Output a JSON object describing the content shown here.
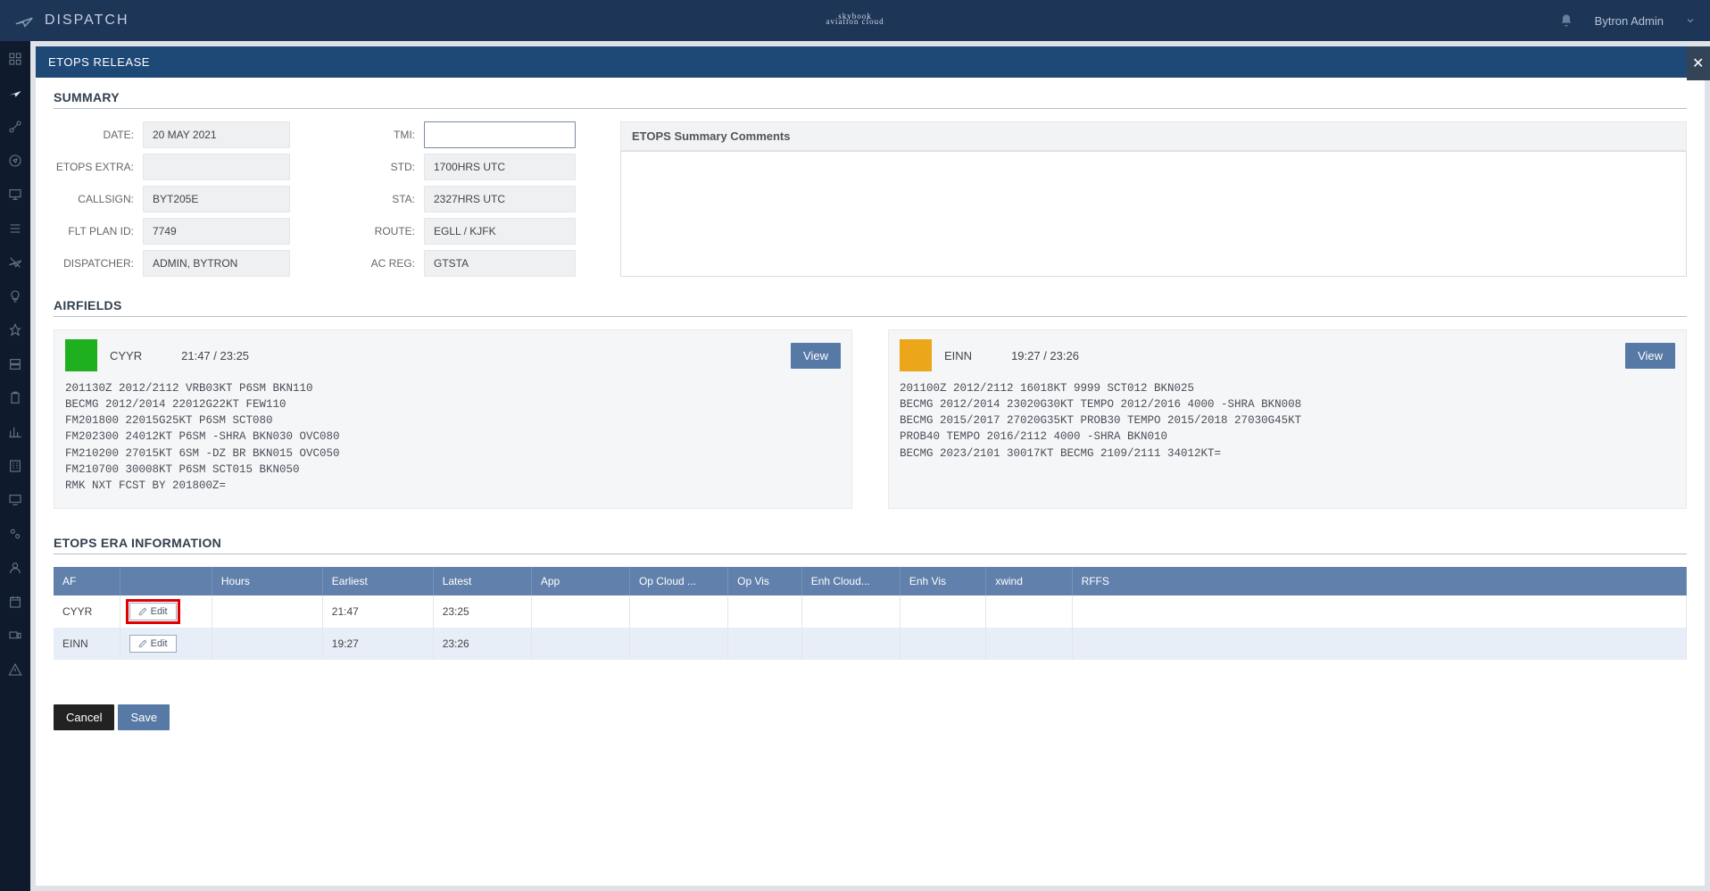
{
  "topbar": {
    "title": "DISPATCH",
    "brand": "skybook",
    "brand_sub": "aviation cloud",
    "user": "Bytron Admin"
  },
  "panel_title": "ETOPS RELEASE",
  "sections": {
    "summary": "SUMMARY",
    "airfields": "AIRFIELDS",
    "era": "ETOPS ERA INFORMATION"
  },
  "summary": {
    "labels": {
      "date": "DATE:",
      "etops_extra": "ETOPS EXTRA:",
      "callsign": "CALLSIGN:",
      "flt_plan_id": "FLT PLAN ID:",
      "dispatcher": "DISPATCHER:",
      "tmi": "TMI:",
      "std": "STD:",
      "sta": "STA:",
      "route": "ROUTE:",
      "ac_reg": "AC REG:"
    },
    "values": {
      "date": "20 MAY 2021",
      "etops_extra": "",
      "callsign": "BYT205E",
      "flt_plan_id": "7749",
      "dispatcher": "ADMIN, BYTRON",
      "tmi": "",
      "std": "1700HRS UTC",
      "sta": "2327HRS UTC",
      "route": "EGLL / KJFK",
      "ac_reg": "GTSTA"
    },
    "comments_label": "ETOPS Summary Comments",
    "comments_value": ""
  },
  "airfields": [
    {
      "status": "green",
      "code": "CYYR",
      "time": "21:47 / 23:25",
      "view": "View",
      "taf": "201130Z 2012/2112 VRB03KT P6SM BKN110\nBECMG 2012/2014 22012G22KT FEW110\nFM201800 22015G25KT P6SM SCT080\nFM202300 24012KT P6SM -SHRA BKN030 OVC080\nFM210200 27015KT 6SM -DZ BR BKN015 OVC050\nFM210700 30008KT P6SM SCT015 BKN050\nRMK NXT FCST BY 201800Z="
    },
    {
      "status": "amber",
      "code": "EINN",
      "time": "19:27 / 23:26",
      "view": "View",
      "taf": "201100Z 2012/2112 16018KT 9999 SCT012 BKN025\nBECMG 2012/2014 23020G30KT TEMPO 2012/2016 4000 -SHRA BKN008\nBECMG 2015/2017 27020G35KT PROB30 TEMPO 2015/2018 27030G45KT\nPROB40 TEMPO 2016/2112 4000 -SHRA BKN010\nBECMG 2023/2101 30017KT BECMG 2109/2111 34012KT="
    }
  ],
  "era_table": {
    "headers": [
      "AF",
      "",
      "Hours",
      "Earliest",
      "Latest",
      "App",
      "Op Cloud ...",
      "Op Vis",
      "Enh Cloud...",
      "Enh Vis",
      "xwind",
      "RFFS"
    ],
    "rows": [
      {
        "af": "CYYR",
        "edit": "Edit",
        "highlight": true,
        "hours": "",
        "earliest": "21:47",
        "latest": "23:25",
        "app": "",
        "opcloud": "",
        "opvis": "",
        "enhcloud": "",
        "enhvis": "",
        "xwind": "",
        "rffs": ""
      },
      {
        "af": "EINN",
        "edit": "Edit",
        "highlight": false,
        "hours": "",
        "earliest": "19:27",
        "latest": "23:26",
        "app": "",
        "opcloud": "",
        "opvis": "",
        "enhcloud": "",
        "enhvis": "",
        "xwind": "",
        "rffs": ""
      }
    ]
  },
  "footer": {
    "cancel": "Cancel",
    "save": "Save"
  }
}
